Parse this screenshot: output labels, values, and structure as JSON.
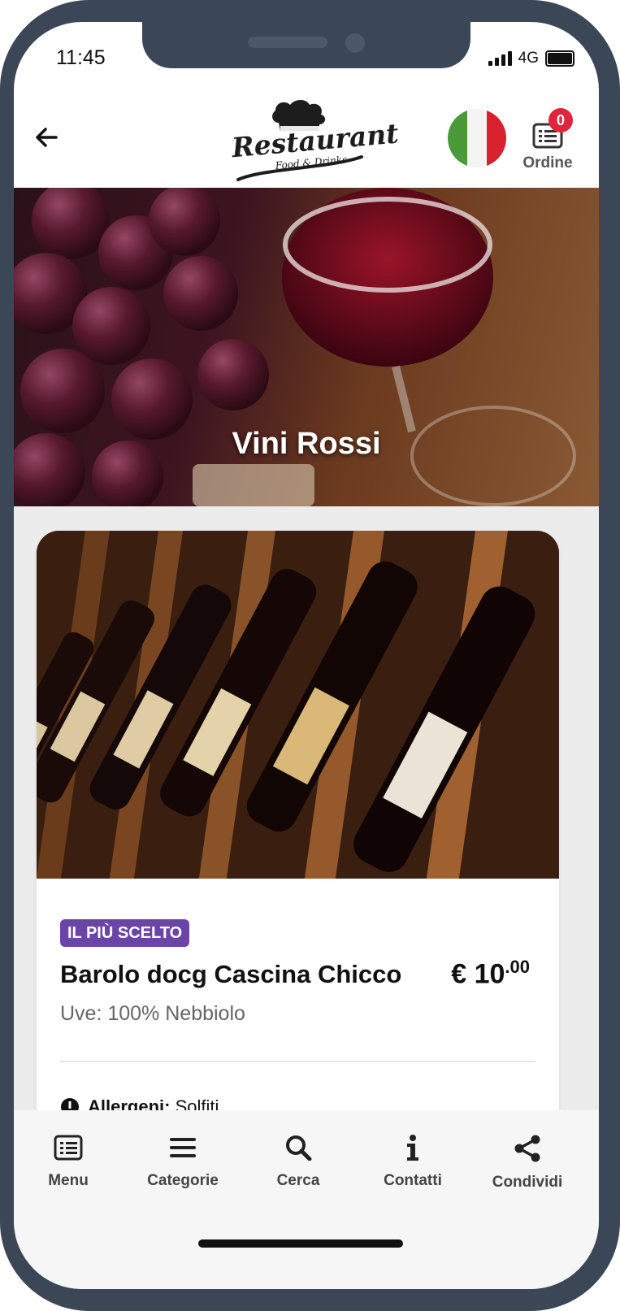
{
  "status": {
    "time": "11:45",
    "network": "4G"
  },
  "header": {
    "logo_title": "Restaurant",
    "logo_subtitle": "Food & Drinks",
    "cart_label": "Ordine",
    "cart_count": "0",
    "language_flag": "italy-flag",
    "colors": {
      "flag_green": "#4a9a3a",
      "flag_white": "#f4f4f4",
      "flag_red": "#d9202f",
      "badge": "#e0243b"
    }
  },
  "hero": {
    "title": "Vini Rossi"
  },
  "item": {
    "tag": "IL PIÙ SCELTO",
    "name": "Barolo docg Cascina Chicco",
    "price_main": "€ 10",
    "price_cents": ".00",
    "description": "Uve: 100% Nebbiolo",
    "allergen_label": "Allergeni:",
    "allergen_value": "Solfiti",
    "tag_color": "#6a45a7"
  },
  "nav": [
    {
      "label": "Menu",
      "icon": "menu-list-icon"
    },
    {
      "label": "Categorie",
      "icon": "hamburger-icon"
    },
    {
      "label": "Cerca",
      "icon": "search-icon"
    },
    {
      "label": "Contatti",
      "icon": "info-icon"
    },
    {
      "label": "Condividi",
      "icon": "share-icon"
    }
  ]
}
